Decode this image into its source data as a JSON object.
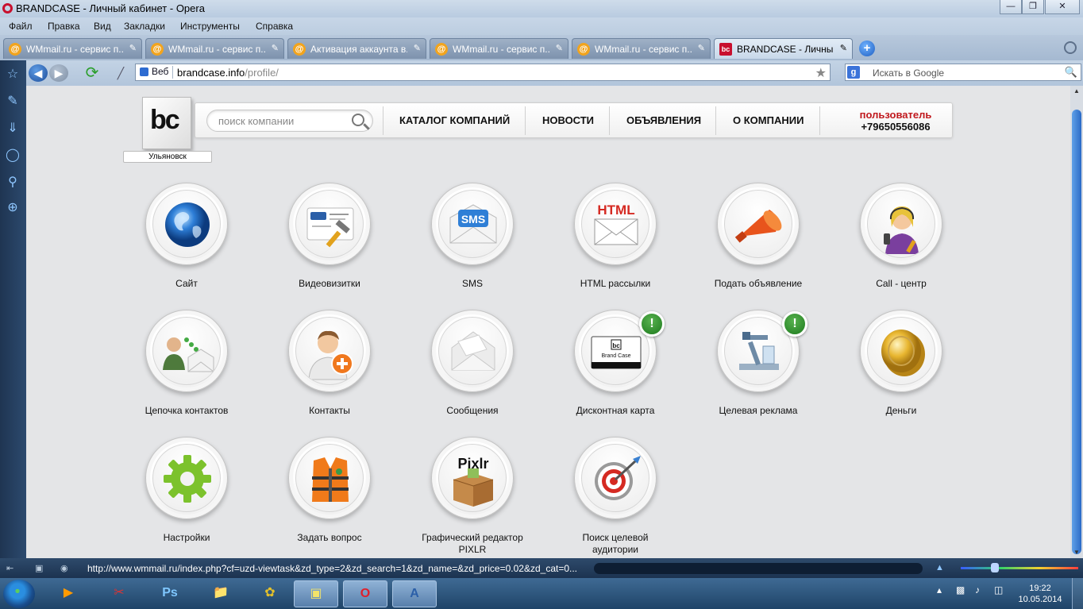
{
  "window": {
    "title": "BRANDCASE - Личный кабинет - Opera"
  },
  "menu": [
    "Файл",
    "Правка",
    "Вид",
    "Закладки",
    "Инструменты",
    "Справка"
  ],
  "tabs": [
    {
      "label": "WMmail.ru - сервис п...",
      "active": false
    },
    {
      "label": "WMmail.ru - сервис п...",
      "active": false
    },
    {
      "label": "Активация аккаунта в...",
      "active": false
    },
    {
      "label": "WMmail.ru - сервис п...",
      "active": false
    },
    {
      "label": "WMmail.ru - сервис п...",
      "active": false
    },
    {
      "label": "BRANDCASE - Личны...",
      "active": true
    }
  ],
  "address": {
    "prefix": "Веб",
    "host": "brandcase.info",
    "path": "/profile/"
  },
  "search": {
    "placeholder": "Искать в Google"
  },
  "site": {
    "logo_text": "bc",
    "city": "Ульяновск",
    "search_placeholder": "поиск компании",
    "nav": [
      "КАТАЛОГ КОМПАНИЙ",
      "НОВОСТИ",
      "ОБЪЯВЛЕНИЯ",
      "О КОМПАНИИ"
    ],
    "user_label": "пользователь",
    "user_phone": "+79650556086"
  },
  "tiles": [
    {
      "label": "Сайт",
      "icon": "globe-icon"
    },
    {
      "label": "Видеовизитки",
      "icon": "video-card-icon"
    },
    {
      "label": "SMS",
      "icon": "sms-envelope-icon",
      "icon_text": "SMS"
    },
    {
      "label": "HTML рассылки",
      "icon": "html-envelope-icon",
      "icon_text": "HTML"
    },
    {
      "label": "Подать объявление",
      "icon": "megaphone-icon"
    },
    {
      "label": "Call - центр",
      "icon": "call-center-icon"
    },
    {
      "label": "Цепочка контактов",
      "icon": "contact-chain-icon"
    },
    {
      "label": "Контакты",
      "icon": "add-contact-icon"
    },
    {
      "label": "Сообщения",
      "icon": "message-envelope-icon"
    },
    {
      "label": "Дисконтная карта",
      "icon": "discount-card-icon",
      "icon_text": "Brand Case",
      "badge": "!"
    },
    {
      "label": "Целевая реклама",
      "icon": "target-ads-icon",
      "badge": "!"
    },
    {
      "label": "Деньги",
      "icon": "coin-icon"
    },
    {
      "label": "Настройки",
      "icon": "gear-icon"
    },
    {
      "label": "Задать вопрос",
      "icon": "life-vest-icon"
    },
    {
      "label": "Графический редактор PIXLR",
      "icon": "pixlr-box-icon",
      "icon_text": "Pixlr"
    },
    {
      "label": "Поиск целевой аудитории",
      "icon": "target-icon"
    }
  ],
  "status": {
    "url": "http://www.wmmail.ru/index.php?cf=uzd-viewtask&zd_type=2&zd_search=1&zd_name=&zd_price=0.02&zd_cat=0..."
  },
  "taskbar": {
    "time": "19:22",
    "date": "10.05.2014"
  },
  "colors": {
    "accent_red": "#c0181d",
    "badge_green": "#2e8b2e"
  }
}
